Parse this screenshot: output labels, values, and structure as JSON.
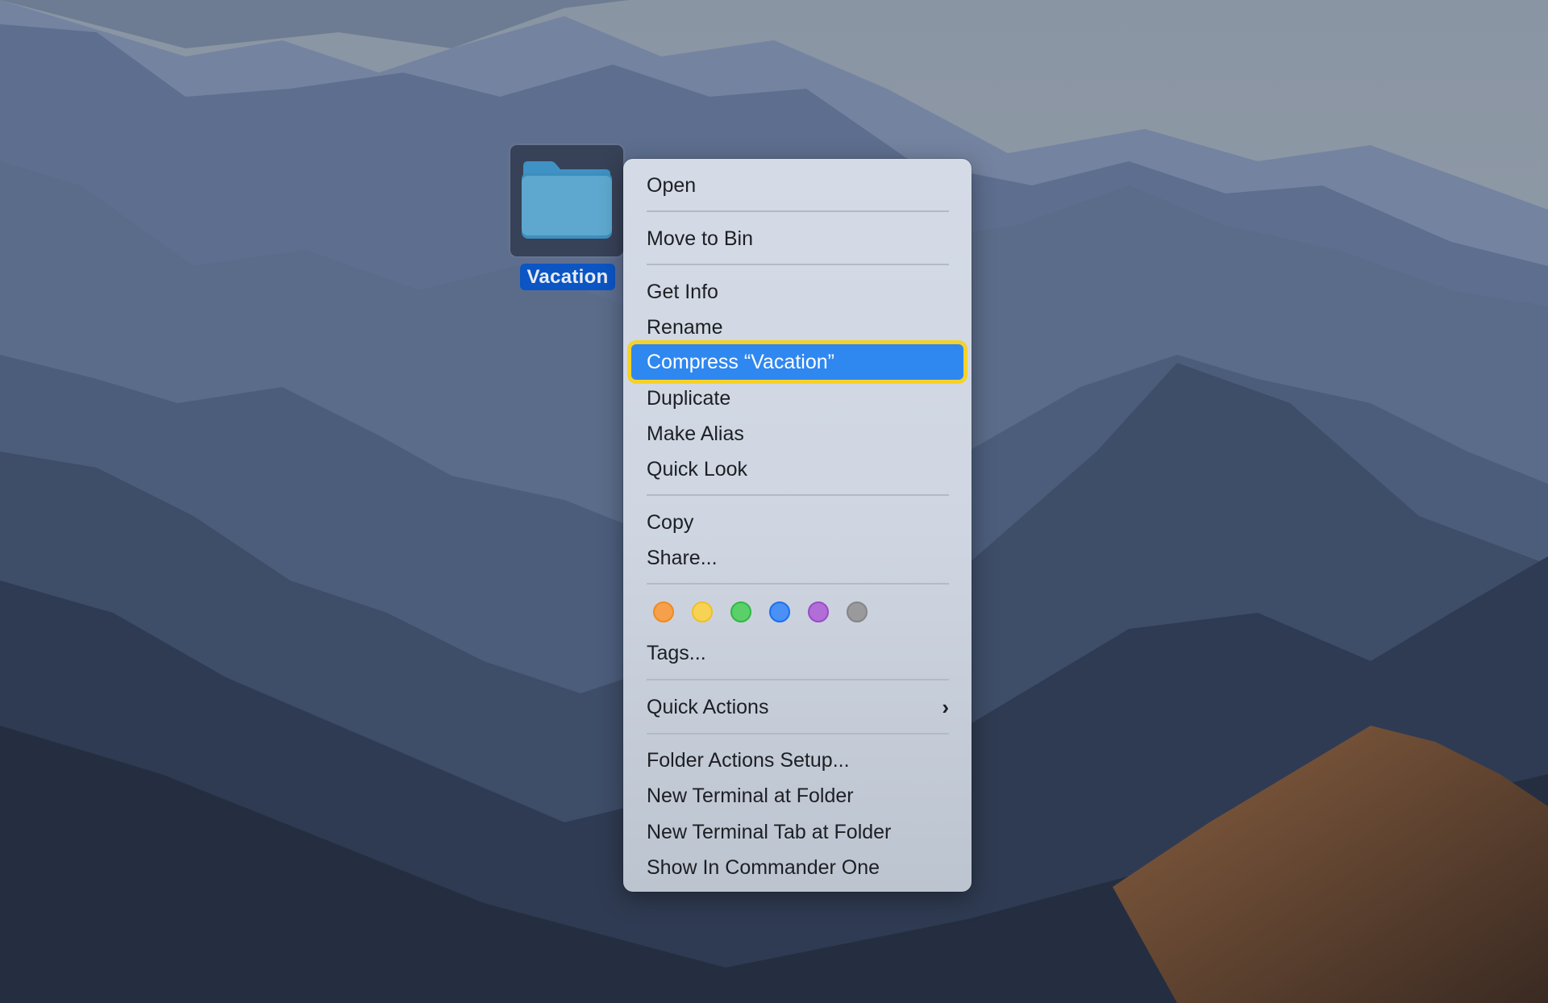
{
  "desktop": {
    "folder": {
      "name": "Vacation",
      "icon": "folder-icon",
      "selected": true
    }
  },
  "context_menu": {
    "items": [
      {
        "label": "Open"
      },
      {
        "label": "Move to Bin"
      },
      {
        "label": "Get Info"
      },
      {
        "label": "Rename"
      },
      {
        "label": "Compress “Vacation”",
        "highlighted": true
      },
      {
        "label": "Duplicate"
      },
      {
        "label": "Make Alias"
      },
      {
        "label": "Quick Look"
      },
      {
        "label": "Copy"
      },
      {
        "label": "Share..."
      },
      {
        "label": "Tags..."
      },
      {
        "label": "Quick Actions",
        "submenu": true,
        "icon": "chevron-right-icon"
      },
      {
        "label": "Folder Actions Setup..."
      },
      {
        "label": "New Terminal at Folder"
      },
      {
        "label": "New Terminal Tab at Folder"
      },
      {
        "label": "Show In Commander One"
      }
    ],
    "tags": [
      {
        "name": "orange",
        "fill": "#f7a04b",
        "stroke": "#f08a1e"
      },
      {
        "name": "yellow",
        "fill": "#f8d254",
        "stroke": "#f0c020"
      },
      {
        "name": "green",
        "fill": "#5bd069",
        "stroke": "#2fb845"
      },
      {
        "name": "blue",
        "fill": "#4a90f5",
        "stroke": "#1c70ee"
      },
      {
        "name": "purple",
        "fill": "#b06ed6",
        "stroke": "#9a4cc8"
      },
      {
        "name": "gray",
        "fill": "#9a9a9c",
        "stroke": "#858587"
      }
    ],
    "highlight_color": "#2f87f0",
    "annotation_outline_color": "#f5d229"
  }
}
